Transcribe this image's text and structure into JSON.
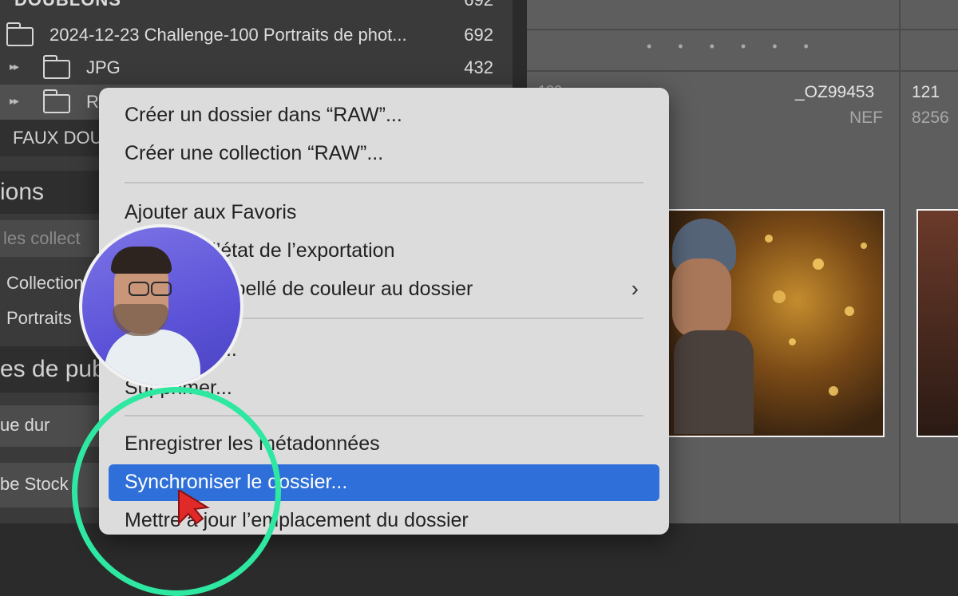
{
  "folders": {
    "top_section_label": "DOUBLONS",
    "top_section_count": "692",
    "parent_folder": {
      "name": "2024-12-23 Challenge-100 Portraits de phot...",
      "count": "692"
    },
    "jpg_folder": {
      "name": "JPG",
      "count": "432"
    },
    "raw_folder": {
      "name": "R"
    }
  },
  "left_panel": {
    "faux_label": "FAUX DOU",
    "collections_header": "ions",
    "collections_filter_placeholder": "les collect",
    "collection_item_1": "Collection",
    "collection_item_2": "Portraits",
    "publish_header": "es de pub",
    "publish_item_1": "ue dur",
    "publish_item_2": "be Stock"
  },
  "grid": {
    "dots": "• • • • • •",
    "cell1_filename": "_OZ99453",
    "cell1_ext": "NEF",
    "cell1_index_partial": "120",
    "cell2_index": "121",
    "cell2_partial": "8256"
  },
  "context_menu": {
    "items": [
      {
        "label": "Créer un dossier dans “RAW”..."
      },
      {
        "label": "Créer une collection “RAW”..."
      },
      {
        "label": "Ajouter aux Favoris"
      },
      {
        "label": "er l’état de l’exportation"
      },
      {
        "label": "ibellé de couleur au dossier"
      },
      {
        "label": "..."
      },
      {
        "label": "Supprimer..."
      },
      {
        "label": "Enregistrer les métadonnées"
      },
      {
        "label": "Synchroniser le dossier..."
      },
      {
        "label": "Mettre à jour l’emplacement du dossier"
      }
    ],
    "submenu_chevron": "›"
  },
  "colors": {
    "selection_blue": "#2f6fd9",
    "highlight_ring": "#2ee8a2",
    "pointer_red": "#e02a2a"
  }
}
